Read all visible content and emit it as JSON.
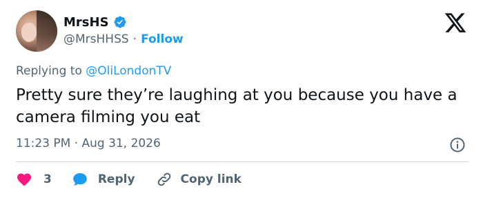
{
  "author": {
    "display_name": "MrsHS",
    "handle": "@MrsHHSS",
    "separator": "·",
    "follow_label": "Follow",
    "verified_icon": "verified-badge-icon"
  },
  "reply_context": {
    "prefix": "Replying to",
    "handle": "@OliLondonTV"
  },
  "tweet": {
    "text": "Pretty sure they’re laughing at you because you have a camera filming you eat",
    "timestamp": "11:23 PM · Aug 31, 2026"
  },
  "actions": {
    "like_count": "3",
    "reply_label": "Reply",
    "copy_link_label": "Copy link"
  },
  "colors": {
    "accent": "#1d9bf0",
    "like": "#f91880",
    "muted": "#536471",
    "text": "#0f1419"
  }
}
